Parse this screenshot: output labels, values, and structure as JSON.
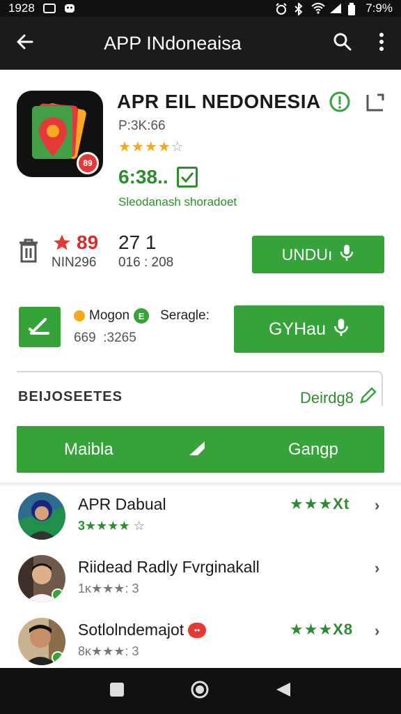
{
  "status_bar": {
    "time": "1928",
    "clock": "7:9%"
  },
  "app_bar": {
    "title": "APP INdoneaisa"
  },
  "app": {
    "title": "APR EIL NEDONESIA",
    "developer": "P:3K:66",
    "rating_stars": 4,
    "rating_max": 5,
    "icon_badge": "89",
    "price": "6:38..",
    "subtitle": "Sleodanash shoradoet"
  },
  "stats": {
    "stat1_value": "89",
    "stat1_label": "NIN296",
    "stat2_value": "27 1",
    "stat2_label": "016 : 208",
    "install_button": "UNDUı"
  },
  "secondary": {
    "mogon_label": "Mogon",
    "e_badge": "E",
    "seragle_label": "Seragle:",
    "numbers": "669  :3265",
    "gmail_button": "GYHau"
  },
  "section": {
    "label": "BEIJOSEETES",
    "link": "Deirdg8"
  },
  "bigbar": {
    "left": "Maibla",
    "right": "Gangp"
  },
  "reviews": [
    {
      "name": "APR Dabual",
      "sub_prefix": "3",
      "sub_stars": "★★★★",
      "sub_suffix": "☆",
      "rating_text": "★★★Xt",
      "badge": ""
    },
    {
      "name": "Riidead Radly Fvrginakall",
      "sub_prefix": "1ĸ",
      "sub_stars": "★★★:",
      "sub_suffix": "3",
      "rating_text": "",
      "badge": ""
    },
    {
      "name": "Sotlolndemajot",
      "sub_prefix": "8ĸ",
      "sub_stars": "★★★:",
      "sub_suffix": "3",
      "rating_text": "★★★X8",
      "badge": "••"
    }
  ],
  "colors": {
    "accent": "#35a33a",
    "appbar": "#1b1b1b",
    "star": "#f4a81d",
    "red": "#d32f2f"
  },
  "icons": [
    "back-arrow-icon",
    "search-icon",
    "more-vert-icon",
    "trash-icon",
    "star-icon",
    "mic-icon",
    "edit-icon",
    "pencil-icon",
    "nav-square-icon",
    "nav-home-icon",
    "nav-back-icon"
  ]
}
